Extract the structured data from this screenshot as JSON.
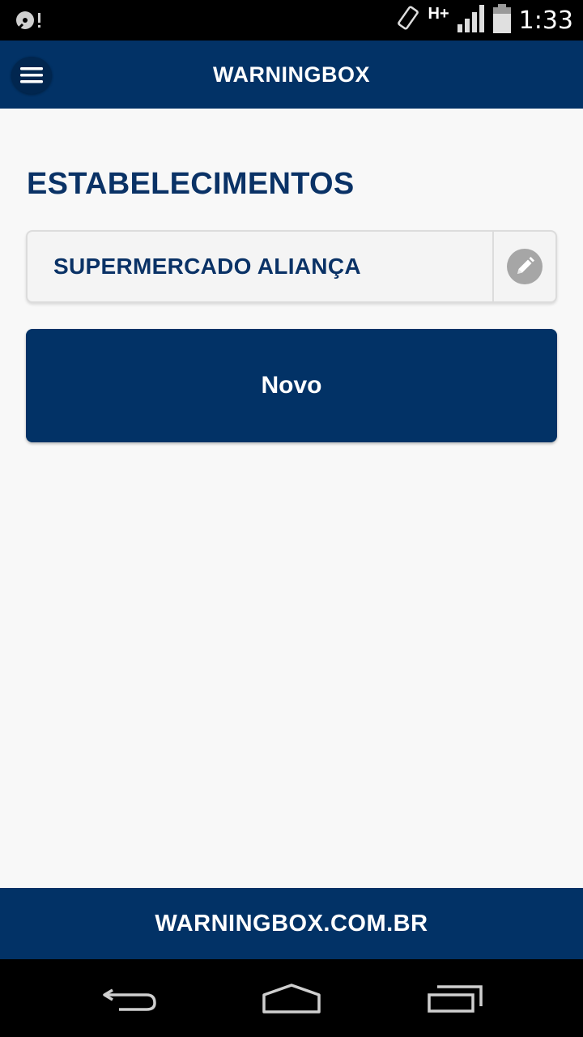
{
  "status_bar": {
    "network": "H+",
    "time": "1:33"
  },
  "app_bar": {
    "title": "WARNINGBOX"
  },
  "main": {
    "section_title": "ESTABELECIMENTOS",
    "items": [
      {
        "label": "SUPERMERCADO ALIANÇA"
      }
    ],
    "new_button_label": "Novo"
  },
  "footer": {
    "text": "WARNINGBOX.COM.BR"
  },
  "nav_bar": {
    "icons": [
      "back-icon",
      "home-icon",
      "recents-icon"
    ]
  },
  "colors": {
    "primary": "#023266",
    "background": "#f8f8f8",
    "edit_icon_bg": "#a6a6a6"
  }
}
